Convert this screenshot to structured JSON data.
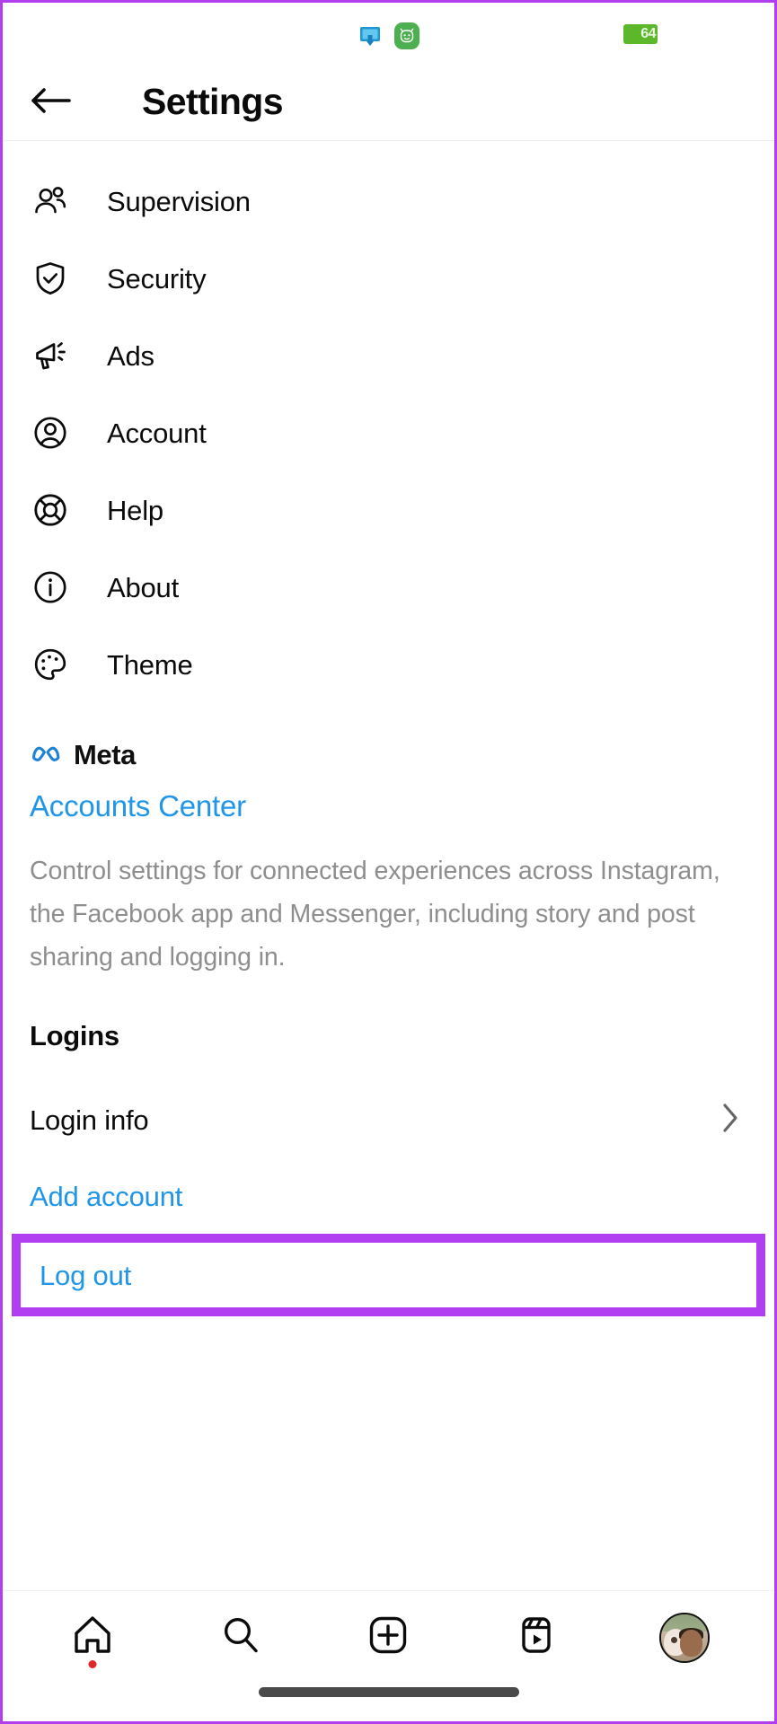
{
  "status_bar": {
    "cast_icon": "screen-cast-icon",
    "app_icon": "green-app-badge-icon",
    "battery_level": "64"
  },
  "header": {
    "back_icon": "back-arrow-icon",
    "title": "Settings"
  },
  "settings": {
    "items": [
      {
        "label": "Supervision",
        "icon": "people-icon"
      },
      {
        "label": "Security",
        "icon": "shield-check-icon"
      },
      {
        "label": "Ads",
        "icon": "megaphone-icon"
      },
      {
        "label": "Account",
        "icon": "person-circle-icon"
      },
      {
        "label": "Help",
        "icon": "life-ring-icon"
      },
      {
        "label": "About",
        "icon": "info-circle-icon"
      },
      {
        "label": "Theme",
        "icon": "palette-icon"
      }
    ]
  },
  "meta": {
    "logo_icon": "meta-infinity-logo",
    "brand": "Meta",
    "accounts_center_link": "Accounts Center",
    "description": "Control settings for connected experiences across Instagram, the Facebook app and Messenger, including story and post sharing and logging in."
  },
  "logins": {
    "heading": "Logins",
    "login_info_label": "Login info",
    "login_info_chevron": "chevron-right-icon",
    "add_account_label": "Add account",
    "log_out_label": "Log out"
  },
  "bottom_nav": {
    "items": [
      {
        "name": "home",
        "icon": "home-icon",
        "badge": true
      },
      {
        "name": "search",
        "icon": "search-icon",
        "badge": false
      },
      {
        "name": "create",
        "icon": "plus-square-icon",
        "badge": false
      },
      {
        "name": "reels",
        "icon": "reels-icon",
        "badge": false
      },
      {
        "name": "profile",
        "icon": "avatar-icon",
        "badge": false
      }
    ]
  },
  "colors": {
    "link_blue": "#2196e9",
    "highlight_purple": "#b13ef0",
    "battery_green": "#5cb82a",
    "badge_red": "#e4262c",
    "muted_text": "#8e8e8e"
  }
}
